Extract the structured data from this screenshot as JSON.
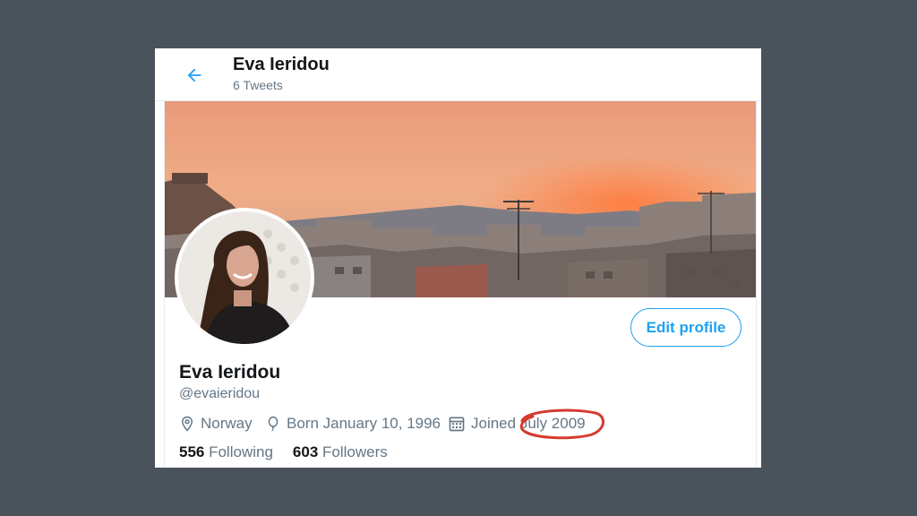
{
  "header": {
    "name": "Eva Ieridou",
    "tweet_count": "6 Tweets",
    "back_icon": "arrow-left-icon"
  },
  "profile": {
    "name": "Eva Ieridou",
    "handle": "@evaieridou",
    "location": "Norway",
    "birthday": "Born January 10, 1996",
    "joined_prefix": "Joined ",
    "joined_date": "July 2009",
    "following_count": "556",
    "following_label": " Following",
    "followers_count": "603",
    "followers_label": " Followers",
    "edit_button": "Edit profile"
  },
  "colors": {
    "accent": "#1da1f2",
    "annotation": "#d63b2f",
    "backdrop": "#4a535c"
  },
  "icons": [
    "arrow-left-icon",
    "location-pin-icon",
    "balloon-icon",
    "calendar-icon"
  ]
}
